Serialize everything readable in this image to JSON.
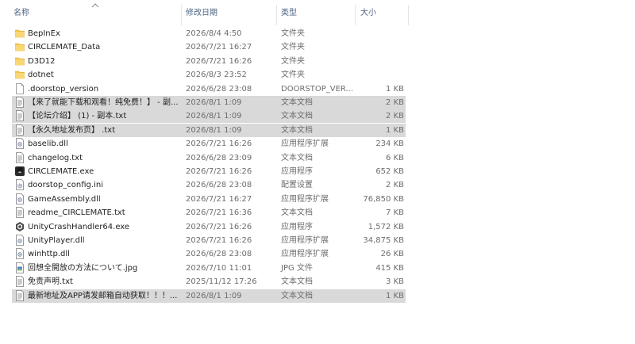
{
  "columns": {
    "name": "名称",
    "date": "修改日期",
    "type": "类型",
    "size": "大小"
  },
  "files": [
    {
      "name": "BepInEx",
      "date": "2026/8/4 4:50",
      "type": "文件夹",
      "size": "",
      "icon": "folder-icon",
      "selected": false
    },
    {
      "name": "CIRCLEMATE_Data",
      "date": "2026/7/21 16:27",
      "type": "文件夹",
      "size": "",
      "icon": "folder-icon",
      "selected": false
    },
    {
      "name": "D3D12",
      "date": "2026/7/21 16:26",
      "type": "文件夹",
      "size": "",
      "icon": "folder-icon",
      "selected": false
    },
    {
      "name": "dotnet",
      "date": "2026/8/3 23:52",
      "type": "文件夹",
      "size": "",
      "icon": "folder-icon",
      "selected": false
    },
    {
      "name": ".doorstop_version",
      "date": "2026/6/28 23:08",
      "type": "DOORSTOP_VER...",
      "size": "1 KB",
      "icon": "blank-file-icon",
      "selected": false
    },
    {
      "name": "【来了就能下载和观看！纯免费！】 - 副...",
      "date": "2026/8/1 1:09",
      "type": "文本文档",
      "size": "2 KB",
      "icon": "text-file-icon",
      "selected": true
    },
    {
      "name": "【论坛介绍】 (1) - 副本.txt",
      "date": "2026/8/1 1:09",
      "type": "文本文档",
      "size": "2 KB",
      "icon": "text-file-icon",
      "selected": true
    },
    {
      "name": "【永久地址发布页】 .txt",
      "date": "2026/8/1 1:09",
      "type": "文本文档",
      "size": "1 KB",
      "icon": "text-file-icon",
      "selected": true
    },
    {
      "name": "baselib.dll",
      "date": "2026/7/21 16:26",
      "type": "应用程序扩展",
      "size": "234 KB",
      "icon": "dll-file-icon",
      "selected": false
    },
    {
      "name": "changelog.txt",
      "date": "2026/6/28 23:09",
      "type": "文本文档",
      "size": "6 KB",
      "icon": "text-file-icon",
      "selected": false
    },
    {
      "name": "CIRCLEMATE.exe",
      "date": "2026/7/21 16:26",
      "type": "应用程序",
      "size": "652 KB",
      "icon": "app-avatar-icon",
      "selected": false
    },
    {
      "name": "doorstop_config.ini",
      "date": "2026/6/28 23:08",
      "type": "配置设置",
      "size": "2 KB",
      "icon": "config-file-icon",
      "selected": false
    },
    {
      "name": "GameAssembly.dll",
      "date": "2026/7/21 16:27",
      "type": "应用程序扩展",
      "size": "76,850 KB",
      "icon": "dll-file-icon",
      "selected": false
    },
    {
      "name": "readme_CIRCLEMATE.txt",
      "date": "2026/7/21 16:36",
      "type": "文本文档",
      "size": "7 KB",
      "icon": "text-file-icon",
      "selected": false
    },
    {
      "name": "UnityCrashHandler64.exe",
      "date": "2026/7/21 16:26",
      "type": "应用程序",
      "size": "1,572 KB",
      "icon": "unity-icon",
      "selected": false
    },
    {
      "name": "UnityPlayer.dll",
      "date": "2026/7/21 16:26",
      "type": "应用程序扩展",
      "size": "34,875 KB",
      "icon": "dll-file-icon",
      "selected": false
    },
    {
      "name": "winhttp.dll",
      "date": "2026/6/28 23:08",
      "type": "应用程序扩展",
      "size": "26 KB",
      "icon": "dll-file-icon",
      "selected": false
    },
    {
      "name": "回想全開放の方法について.jpg",
      "date": "2026/7/10 11:01",
      "type": "JPG 文件",
      "size": "415 KB",
      "icon": "image-file-icon",
      "selected": false
    },
    {
      "name": "免责声明.txt",
      "date": "2025/11/12 17:26",
      "type": "文本文档",
      "size": "3 KB",
      "icon": "text-file-icon",
      "selected": false
    },
    {
      "name": "最新地址及APP请发邮箱自动获取！！！...",
      "date": "2026/8/1 1:09",
      "type": "文本文档",
      "size": "1 KB",
      "icon": "text-file-icon",
      "selected": true
    }
  ]
}
